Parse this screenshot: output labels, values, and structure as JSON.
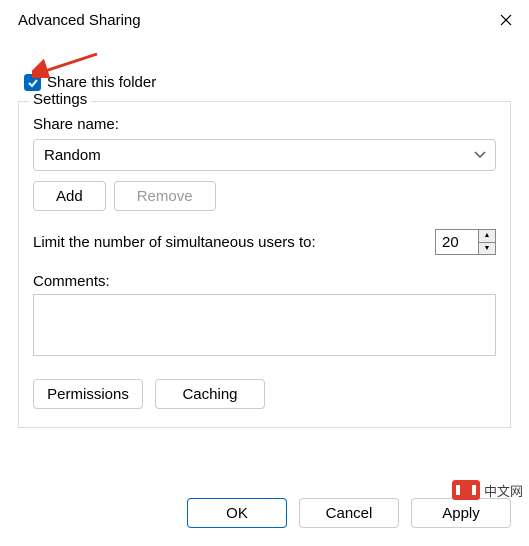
{
  "title": "Advanced Sharing",
  "share_checkbox": {
    "checked": true,
    "label": "Share this folder"
  },
  "settings": {
    "legend": "Settings",
    "share_name_label": "Share name:",
    "share_name_value": "Random",
    "add_btn": "Add",
    "remove_btn": "Remove",
    "limit_label": "Limit the number of simultaneous users to:",
    "limit_value": "20",
    "comments_label": "Comments:",
    "comments_value": "",
    "permissions_btn": "Permissions",
    "caching_btn": "Caching"
  },
  "footer": {
    "ok": "OK",
    "cancel": "Cancel",
    "apply": "Apply"
  },
  "watermark": "中文网"
}
